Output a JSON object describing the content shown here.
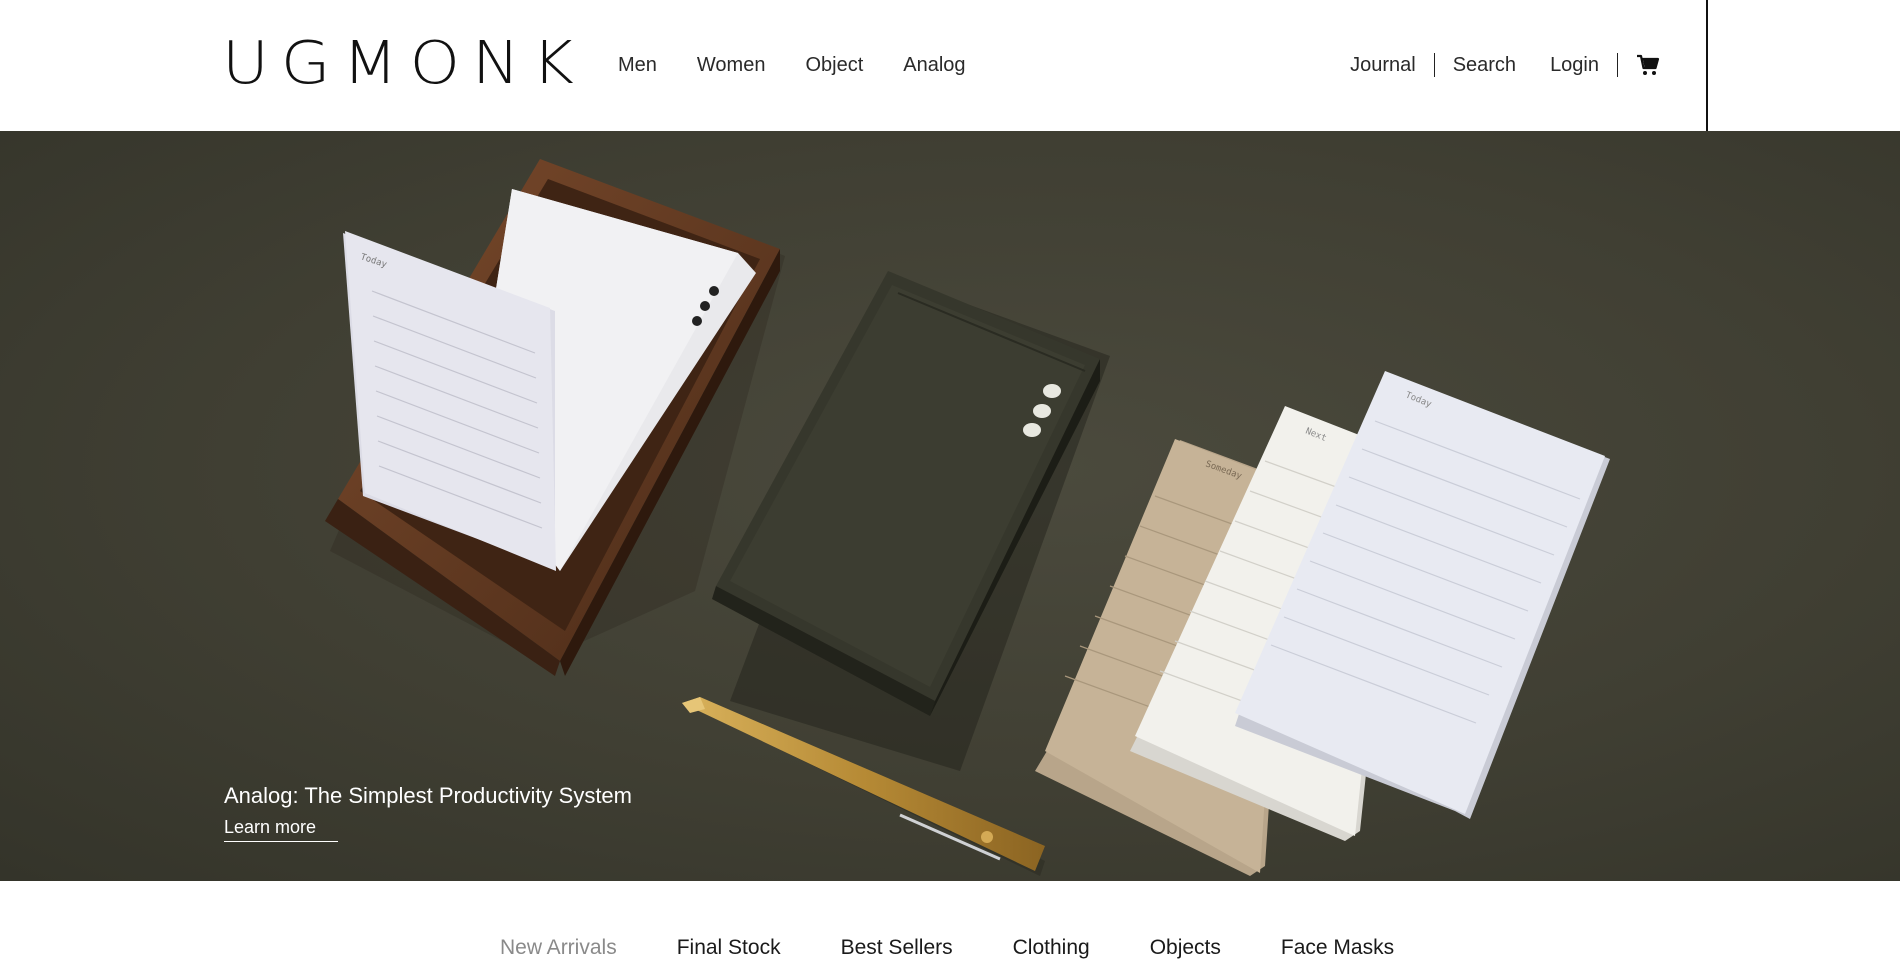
{
  "brand": {
    "logo_text": "UGMONK"
  },
  "nav": {
    "primary": [
      "Men",
      "Women",
      "Object",
      "Analog"
    ],
    "secondary": {
      "journal": "Journal",
      "search": "Search",
      "login": "Login",
      "cart_icon": "cart-icon"
    }
  },
  "hero": {
    "title": "Analog: The Simplest Productivity System",
    "link": "Learn more",
    "background_color": "#403f33",
    "card_labels": {
      "today": "Today",
      "next": "Next",
      "someday": "Someday"
    }
  },
  "tabs": {
    "items": [
      "New Arrivals",
      "Final Stock",
      "Best Sellers",
      "Clothing",
      "Objects",
      "Face Masks"
    ],
    "active": "New Arrivals"
  }
}
